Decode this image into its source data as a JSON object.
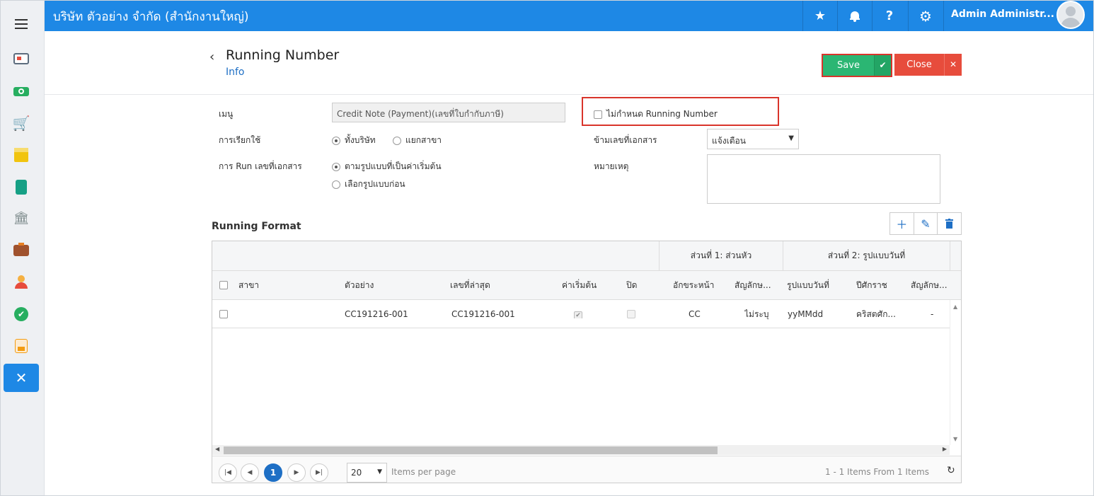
{
  "topbar": {
    "company": "บริษัท ตัวอย่าง จำกัด (สำนักงานใหญ่)",
    "admin_name": "Admin Administr...",
    "star_glyph": "★",
    "bell_glyph": "🔔",
    "help_glyph": "?",
    "gear_glyph": "⚙"
  },
  "sidebar": {
    "items": [
      {
        "icon": "monitor-icon",
        "color": "#e74c3c"
      },
      {
        "icon": "cash-icon",
        "color": "#27ae60"
      },
      {
        "icon": "cart-icon",
        "color": "#e74c3c"
      },
      {
        "icon": "box-icon",
        "color": "#f1c40f"
      },
      {
        "icon": "book-icon",
        "color": "#16a085"
      },
      {
        "icon": "bank-icon",
        "color": "#7f8c8d"
      },
      {
        "icon": "wallet-icon",
        "color": "#a0522d"
      },
      {
        "icon": "person-icon",
        "color": "#e67e22"
      },
      {
        "icon": "check-circle-icon",
        "color": "#27ae60"
      },
      {
        "icon": "transfer-icon",
        "color": "#f39c12"
      },
      {
        "icon": "tools-icon",
        "color": "#ffffff"
      }
    ]
  },
  "header": {
    "title": "Running Number",
    "subtitle": "Info",
    "save_label": "Save",
    "close_label": "Close"
  },
  "form": {
    "menu_label": "เมนู",
    "menu_value": "Credit Note (Payment)(เลขที่ใบกำกับภาษี)",
    "usage_label": "การเรียกใช้",
    "usage_options": [
      "ทั้งบริษัท",
      "แยกสาขา"
    ],
    "run_label": "การ Run เลขที่เอกสาร",
    "run_options": [
      "ตามรูปแบบที่เป็นค่าเริ่มต้น",
      "เลือกรูปแบบก่อน"
    ],
    "no_running_label": "ไม่กำหนด Running Number",
    "skip_label": "ข้ามเลขที่เอกสาร",
    "skip_value": "แจ้งเตือน",
    "note_label": "หมายเหตุ"
  },
  "running_format": {
    "title": "Running Format",
    "group_headers": [
      "ส่วนที่ 1: ส่วนหัว",
      "ส่วนที่ 2: รูปแบบวันที่"
    ],
    "columns": [
      "สาขา",
      "ตัวอย่าง",
      "เลขที่ล่าสุด",
      "ค่าเริ่มต้น",
      "ปิด",
      "อักขระหน้า",
      "สัญลักษ...",
      "รูปแบบวันที่",
      "ปีศักราช",
      "สัญลักษ..."
    ],
    "rows": [
      {
        "branch": "",
        "example": "CC191216-001",
        "latest": "CC191216-001",
        "default": true,
        "closed": false,
        "prefix": "CC",
        "symbol1": "ไม่ระบุ",
        "date_format": "yyMMdd",
        "era": "คริสตศัก...",
        "symbol2": "-"
      }
    ],
    "pager": {
      "current_page": "1",
      "page_size": "20",
      "items_per_page": "Items per page",
      "info": "1 - 1 Items From 1 Items"
    }
  }
}
